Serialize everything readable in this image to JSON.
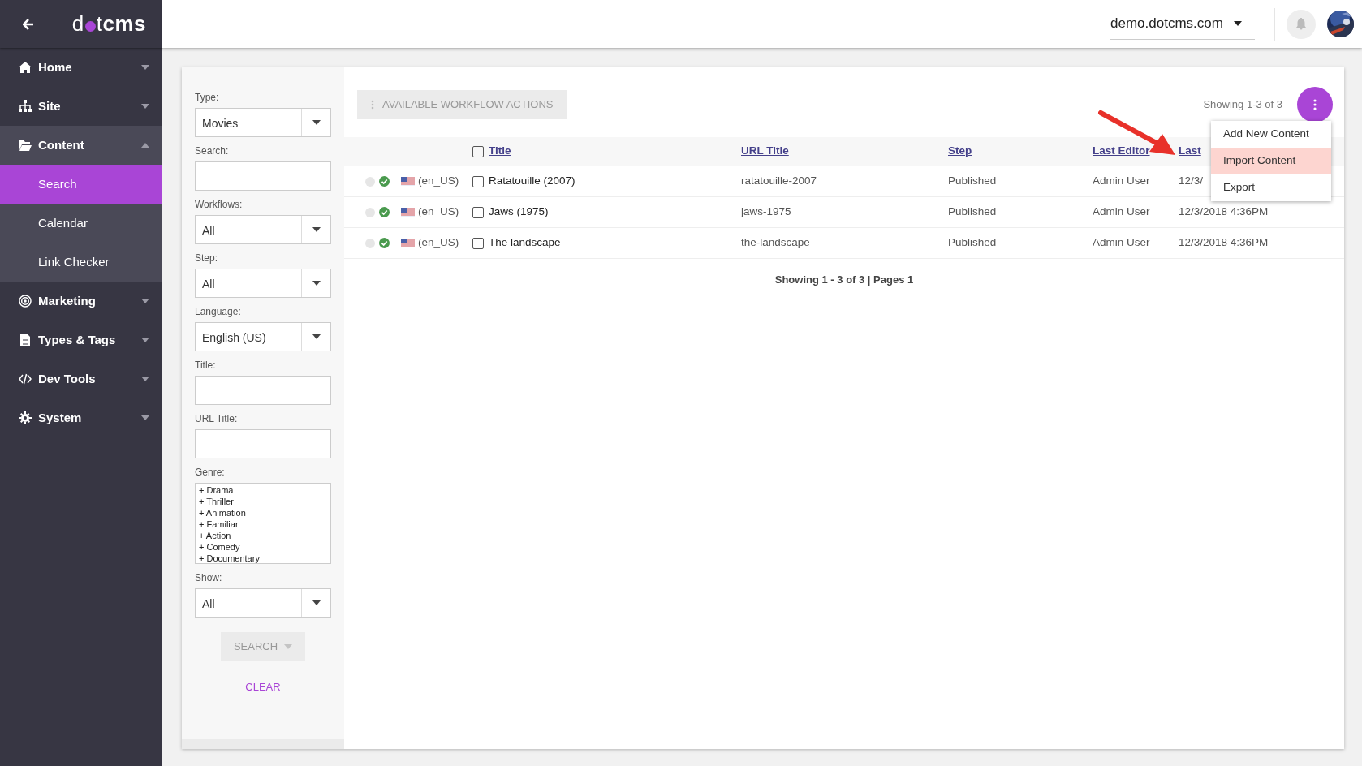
{
  "logo": {
    "lead": "d",
    "tail": "t",
    "bold": "cms"
  },
  "site_selector": {
    "value": "demo.dotcms.com"
  },
  "sidebar": {
    "items": [
      {
        "label": "Home",
        "expanded": false
      },
      {
        "label": "Site",
        "expanded": false
      },
      {
        "label": "Content",
        "expanded": true,
        "children": [
          {
            "label": "Search",
            "selected": true
          },
          {
            "label": "Calendar",
            "selected": false
          },
          {
            "label": "Link Checker",
            "selected": false
          }
        ]
      },
      {
        "label": "Marketing",
        "expanded": false
      },
      {
        "label": "Types & Tags",
        "expanded": false
      },
      {
        "label": "Dev Tools",
        "expanded": false
      },
      {
        "label": "System",
        "expanded": false
      }
    ]
  },
  "filters": [
    {
      "kind": "select",
      "label": "Type:",
      "value": "Movies"
    },
    {
      "kind": "text",
      "label": "Search:"
    },
    {
      "kind": "select",
      "label": "Workflows:",
      "value": "All"
    },
    {
      "kind": "select",
      "label": "Step:",
      "value": "All"
    },
    {
      "kind": "select",
      "label": "Language:",
      "value": "English (US)"
    },
    {
      "kind": "text",
      "label": "Title:"
    },
    {
      "kind": "text",
      "label": "URL Title:"
    },
    {
      "kind": "list",
      "label": "Genre:",
      "options": [
        "+ Drama",
        "+ Thriller",
        "+ Animation",
        "+ Familiar",
        "+ Action",
        "+ Comedy",
        "+ Documentary"
      ]
    },
    {
      "kind": "select",
      "label": "Show:",
      "value": "All"
    }
  ],
  "search_button": {
    "label": "SEARCH",
    "disabled": true
  },
  "clear_link": "CLEAR",
  "workflow_button": {
    "label": "AVAILABLE WORKFLOW ACTIONS",
    "disabled": true
  },
  "showing_count": "Showing 1-3 of 3",
  "table": {
    "select_all_checked": false,
    "columns": [
      "Title",
      "URL Title",
      "Step",
      "Last Editor",
      "Last"
    ],
    "rows": [
      {
        "live": false,
        "published": true,
        "language": "(en_US)",
        "checked": false,
        "title": "Ratatouille (2007)",
        "url_title": "ratatouille-2007",
        "step": "Published",
        "editor": "Admin User",
        "date": "12/3/"
      },
      {
        "live": false,
        "published": true,
        "language": "(en_US)",
        "checked": false,
        "title": "Jaws (1975)",
        "url_title": "jaws-1975",
        "step": "Published",
        "editor": "Admin User",
        "date": "12/3/2018 4:36PM"
      },
      {
        "live": false,
        "published": true,
        "language": "(en_US)",
        "checked": false,
        "title": "The landscape",
        "url_title": "the-landscape",
        "step": "Published",
        "editor": "Admin User",
        "date": "12/3/2018 4:36PM"
      }
    ]
  },
  "pagination": "Showing 1 - 3 of 3 | Pages 1",
  "menu": {
    "items": [
      {
        "label": "Add New Content",
        "selected": false
      },
      {
        "label": "Import Content",
        "selected": true
      },
      {
        "label": "Export",
        "selected": false
      }
    ]
  }
}
